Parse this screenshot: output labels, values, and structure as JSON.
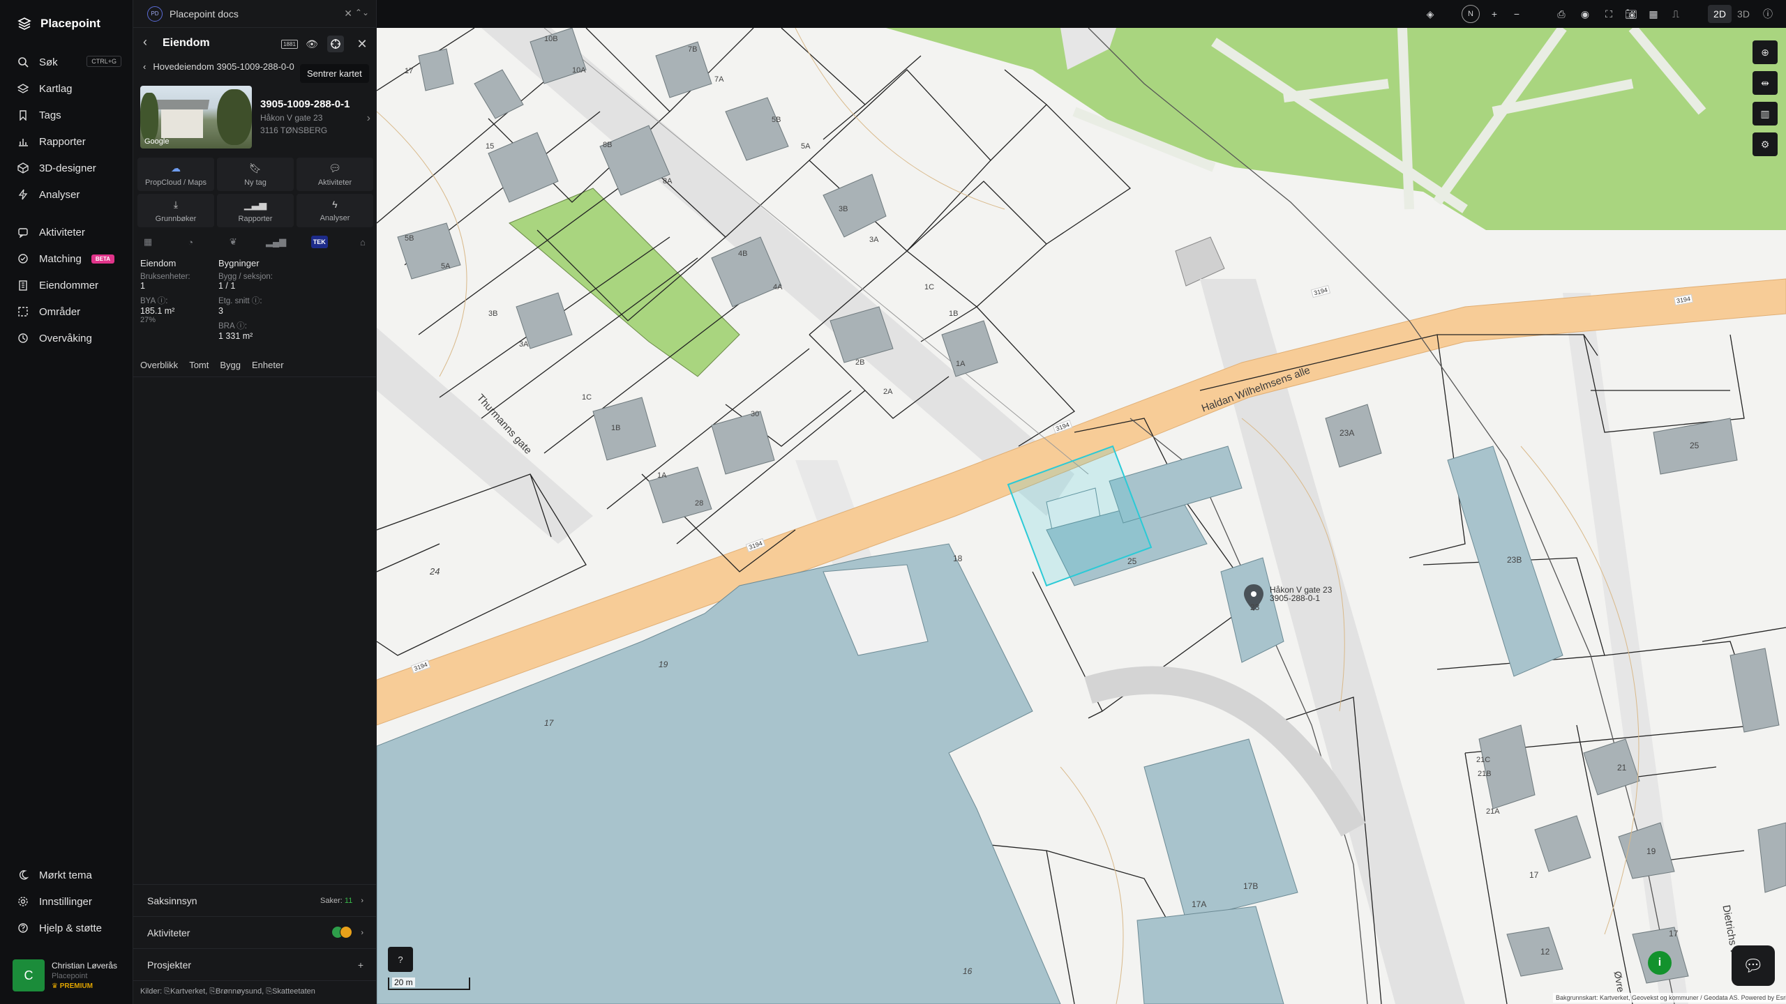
{
  "nav": {
    "brand": "Placepoint",
    "items": [
      {
        "label": "Søk",
        "shortcut": "CTRL+G",
        "icon": "search-icon"
      },
      {
        "label": "Kartlag",
        "icon": "layers-icon"
      },
      {
        "label": "Tags",
        "icon": "bookmark-icon"
      },
      {
        "label": "Rapporter",
        "icon": "bar-chart-icon"
      },
      {
        "label": "3D-designer",
        "icon": "cube-icon"
      },
      {
        "label": "Analyser",
        "icon": "bolt-icon"
      },
      {
        "label": "Aktiviteter",
        "icon": "chat-icon"
      },
      {
        "label": "Matching",
        "badge": "BETA",
        "icon": "handshake-icon"
      },
      {
        "label": "Eiendommer",
        "icon": "building-icon"
      },
      {
        "label": "Områder",
        "icon": "area-icon"
      },
      {
        "label": "Overvåking",
        "icon": "clock-icon"
      }
    ],
    "bottom": [
      {
        "label": "Mørkt tema",
        "icon": "moon-icon"
      },
      {
        "label": "Innstillinger",
        "icon": "gear-icon"
      },
      {
        "label": "Hjelp & støtte",
        "icon": "help-icon"
      }
    ],
    "user": {
      "initial": "C",
      "name": "Christian Løverås",
      "org": "Placepoint",
      "tier": "PREMIUM"
    }
  },
  "panel": {
    "docs_badge": "PD",
    "docs_title": "Placepoint docs",
    "header_title": "Eiendom",
    "header_badge": "1881",
    "tooltip": "Sentrer kartet",
    "breadcrumb": "Hovedeiendom 3905-1009-288-0-0",
    "property_id": "3905-1009-288-0-1",
    "address_line1": "Håkon V gate 23",
    "address_line2": "3116 TØNSBERG",
    "thumb_label": "Google",
    "actions": [
      {
        "label": "PropCloud / Maps",
        "icon": "cloud-icon"
      },
      {
        "label": "Ny tag",
        "icon": "bookmark-icon"
      },
      {
        "label": "Aktiviteter",
        "icon": "chat-icon"
      },
      {
        "label": "Grunnbøker",
        "icon": "download-icon"
      },
      {
        "label": "Rapporter",
        "icon": "bar-chart-icon"
      },
      {
        "label": "Analyser",
        "icon": "bolt-icon"
      }
    ],
    "tek_label": "TEK",
    "stats": {
      "col1_title": "Eiendom",
      "bruksenheter_label": "Bruksenheter:",
      "bruksenheter_value": "1",
      "bya_label": "BYA ⓘ:",
      "bya_value": "185.1 m²",
      "bya_pct": "27%",
      "col2_title": "Bygninger",
      "bygg_label": "Bygg / seksjon:",
      "bygg_value": "1 / 1",
      "etg_label": "Etg. snitt ⓘ:",
      "etg_value": "3",
      "bra_label": "BRA ⓘ:",
      "bra_value": "1 331 m²"
    },
    "sub_tabs": [
      "Overblikk",
      "Tomt",
      "Bygg",
      "Enheter"
    ],
    "rows": {
      "saksinnsyn": "Saksinnsyn",
      "saker_label": "Saker:",
      "saker_count": "11",
      "aktiviteter": "Aktiviteter",
      "prosjekter": "Prosjekter",
      "plus": "+"
    },
    "sources_prefix": "Kilder:",
    "sources": [
      "Kartverket,",
      "Brønnøysund,",
      "Skatteetaten"
    ]
  },
  "topbar": {
    "compass": "N",
    "mode_2d": "2D",
    "mode_3d": "3D"
  },
  "map": {
    "scale": "20 m",
    "credits": "Bakgrunnskart: Kartverket, Geovekst og kommuner / Geodata AS. Powered by Esri",
    "pin_label_1": "Håkon V gate 23",
    "pin_label_2": "3905-288-0-1",
    "street_labels": [
      "Haldan Wilhelmsens alle",
      "Thurmanns gate",
      "Dietrichs vei",
      "Øvre"
    ],
    "road_numbers": [
      "3194",
      "3194",
      "3194",
      "3194",
      "3194"
    ],
    "building_numbers": [
      "10B",
      "10A",
      "7B",
      "7A",
      "17",
      "15",
      "8B",
      "8A",
      "5B",
      "5A",
      "5B",
      "5A",
      "3B",
      "3A",
      "4B",
      "4A",
      "3B",
      "3A",
      "1C",
      "1B",
      "1A",
      "2B",
      "2A",
      "1C",
      "1B",
      "30",
      "1A",
      "28",
      "24",
      "18",
      "25",
      "23",
      "23A",
      "23B",
      "25",
      "19",
      "17",
      "21C",
      "21B",
      "21A",
      "21",
      "17B",
      "17A",
      "16",
      "19",
      "17",
      "17",
      "12"
    ]
  },
  "colors": {
    "green_area": "#a8d57d",
    "road": "#f7cc97",
    "building": "#a8c3cc",
    "selected": "#2bcad6"
  }
}
